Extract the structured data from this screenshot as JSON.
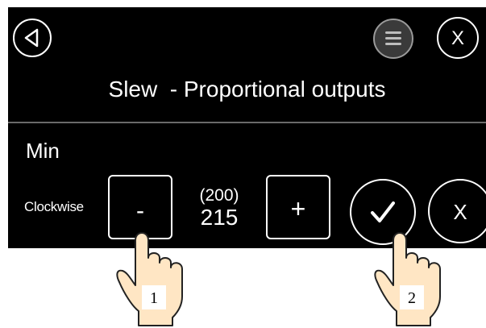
{
  "header": {
    "title": "Slew  - Proportional outputs",
    "back_icon": "back-triangle-icon",
    "menu_icon": "menu-icon",
    "close_label": "X"
  },
  "section": {
    "label": "Min"
  },
  "control": {
    "direction_label": "Clockwise",
    "decrement_label": "-",
    "increment_label": "+",
    "previous_value": "(200)",
    "current_value": "215",
    "confirm_icon": "checkmark-icon",
    "cancel_label": "X"
  },
  "annotations": [
    {
      "number": "1"
    },
    {
      "number": "2"
    }
  ],
  "colors": {
    "screen_bg": "#000000",
    "foreground": "#ffffff",
    "menu_button_bg": "#3a3a3a",
    "hand_fill": "#ffe6c4"
  }
}
